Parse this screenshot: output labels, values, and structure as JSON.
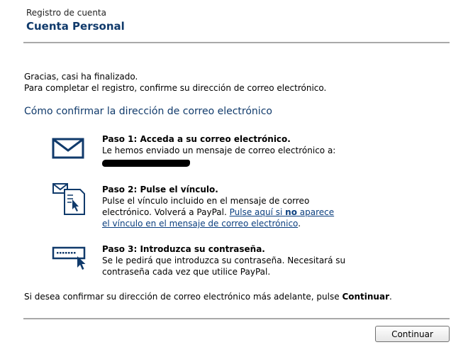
{
  "header": {
    "subtitle": "Registro de cuenta",
    "title": "Cuenta Personal"
  },
  "intro": {
    "line1": "Gracias, casi ha finalizado.",
    "line2": "Para completar el registro, confirme su dirección de correo electrónico."
  },
  "section_heading": "Cómo confirmar la dirección de correo electrónico",
  "steps": [
    {
      "icon": "envelope-icon",
      "title": "Paso 1: Acceda a su correo electrónico.",
      "text": "Le hemos enviado un mensaje de correo electrónico a:"
    },
    {
      "icon": "email-document-cursor-icon",
      "title": "Paso 2: Pulse el vínculo.",
      "text_line1": "Pulse el vínculo incluido en el mensaje de correo",
      "text_line2": "electrónico. Volverá a PayPal.",
      "link_part1": "Pulse aquí si ",
      "link_bold": "no",
      "link_part2": " aparece",
      "link_line2": "el vínculo en el mensaje de correo electrónico",
      "trailing": "."
    },
    {
      "icon": "password-field-cursor-icon",
      "title": "Paso 3: Introduzca su contraseña.",
      "text_line1": "Se le pedirá que introduzca su contraseña. Necesitará su",
      "text_line2": "contraseña cada vez que utilice PayPal."
    }
  ],
  "footer_note": {
    "text": "Si desea confirmar su dirección de correo electrónico más adelante, pulse ",
    "bold": "Continuar",
    "trailing": "."
  },
  "continue_button": "Continuar",
  "colors": {
    "heading_blue": "#103a6b",
    "link_blue": "#0b3f7f",
    "rule_gray": "#a9a9a9"
  }
}
